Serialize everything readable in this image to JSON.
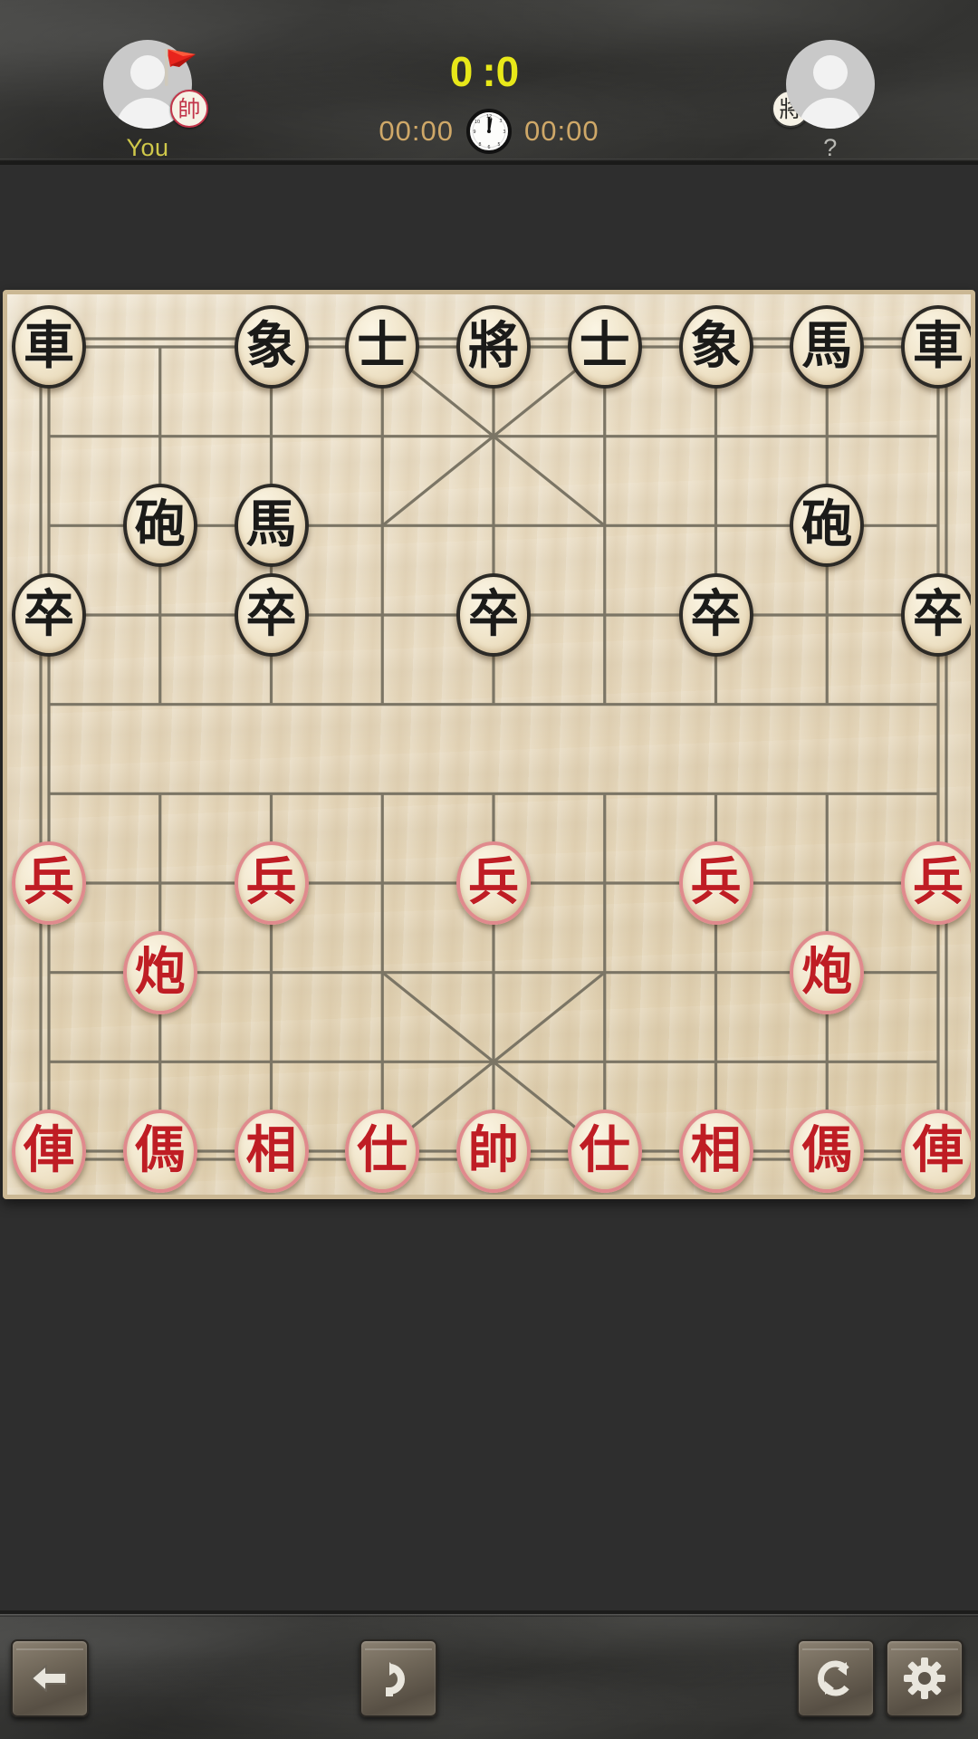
{
  "header": {
    "players": {
      "left": {
        "name": "You",
        "avatar_icon": "person-avatar-icon",
        "flag_icon": "red-flag-icon",
        "side_badge": "帥",
        "side_badge_name": "red-general-badge",
        "name_color": "#cfc84a"
      },
      "right": {
        "name": "?",
        "avatar_icon": "person-avatar-icon",
        "side_badge": "將",
        "side_badge_name": "black-general-badge",
        "name_color": "#b9b9b4"
      }
    },
    "score": {
      "left": "0",
      "separator": ":",
      "right": "0",
      "color": "#e8e819"
    },
    "clock_icon": "analog-clock-icon",
    "timers": {
      "left": "00:00",
      "right": "00:00",
      "color": "#cfa868"
    }
  },
  "board": {
    "files": 9,
    "ranks": 10,
    "river_label": "",
    "pieces": [
      {
        "name": "black-chariot",
        "glyph": "車",
        "side": "black",
        "file": 1,
        "rank": 1
      },
      {
        "name": "black-elephant",
        "glyph": "象",
        "side": "black",
        "file": 3,
        "rank": 1
      },
      {
        "name": "black-advisor",
        "glyph": "士",
        "side": "black",
        "file": 4,
        "rank": 1
      },
      {
        "name": "black-general",
        "glyph": "將",
        "side": "black",
        "file": 5,
        "rank": 1
      },
      {
        "name": "black-advisor",
        "glyph": "士",
        "side": "black",
        "file": 6,
        "rank": 1
      },
      {
        "name": "black-elephant",
        "glyph": "象",
        "side": "black",
        "file": 7,
        "rank": 1
      },
      {
        "name": "black-horse",
        "glyph": "馬",
        "side": "black",
        "file": 8,
        "rank": 1
      },
      {
        "name": "black-chariot",
        "glyph": "車",
        "side": "black",
        "file": 9,
        "rank": 1
      },
      {
        "name": "black-cannon",
        "glyph": "砲",
        "side": "black",
        "file": 2,
        "rank": 3
      },
      {
        "name": "black-horse",
        "glyph": "馬",
        "side": "black",
        "file": 3,
        "rank": 3
      },
      {
        "name": "black-cannon",
        "glyph": "砲",
        "side": "black",
        "file": 8,
        "rank": 3
      },
      {
        "name": "black-soldier",
        "glyph": "卒",
        "side": "black",
        "file": 1,
        "rank": 4
      },
      {
        "name": "black-soldier",
        "glyph": "卒",
        "side": "black",
        "file": 3,
        "rank": 4
      },
      {
        "name": "black-soldier",
        "glyph": "卒",
        "side": "black",
        "file": 5,
        "rank": 4
      },
      {
        "name": "black-soldier",
        "glyph": "卒",
        "side": "black",
        "file": 7,
        "rank": 4
      },
      {
        "name": "black-soldier",
        "glyph": "卒",
        "side": "black",
        "file": 9,
        "rank": 4
      },
      {
        "name": "red-soldier",
        "glyph": "兵",
        "side": "red",
        "file": 1,
        "rank": 7
      },
      {
        "name": "red-soldier",
        "glyph": "兵",
        "side": "red",
        "file": 3,
        "rank": 7
      },
      {
        "name": "red-soldier",
        "glyph": "兵",
        "side": "red",
        "file": 5,
        "rank": 7
      },
      {
        "name": "red-soldier",
        "glyph": "兵",
        "side": "red",
        "file": 7,
        "rank": 7
      },
      {
        "name": "red-soldier",
        "glyph": "兵",
        "side": "red",
        "file": 9,
        "rank": 7
      },
      {
        "name": "red-cannon",
        "glyph": "炮",
        "side": "red",
        "file": 2,
        "rank": 8
      },
      {
        "name": "red-cannon",
        "glyph": "炮",
        "side": "red",
        "file": 8,
        "rank": 8
      },
      {
        "name": "red-chariot",
        "glyph": "俥",
        "side": "red",
        "file": 1,
        "rank": 10
      },
      {
        "name": "red-horse",
        "glyph": "傌",
        "side": "red",
        "file": 2,
        "rank": 10
      },
      {
        "name": "red-elephant",
        "glyph": "相",
        "side": "red",
        "file": 3,
        "rank": 10
      },
      {
        "name": "red-advisor",
        "glyph": "仕",
        "side": "red",
        "file": 4,
        "rank": 10
      },
      {
        "name": "red-general",
        "glyph": "帥",
        "side": "red",
        "file": 5,
        "rank": 10
      },
      {
        "name": "red-advisor",
        "glyph": "仕",
        "side": "red",
        "file": 6,
        "rank": 10
      },
      {
        "name": "red-elephant",
        "glyph": "相",
        "side": "red",
        "file": 7,
        "rank": 10
      },
      {
        "name": "red-horse",
        "glyph": "傌",
        "side": "red",
        "file": 8,
        "rank": 10
      },
      {
        "name": "red-chariot",
        "glyph": "俥",
        "side": "red",
        "file": 9,
        "rank": 10
      }
    ]
  },
  "toolbar": {
    "buttons": [
      {
        "name": "back-button",
        "icon": "arrow-left-icon"
      },
      {
        "name": "undo-button",
        "icon": "undo-arrow-icon"
      },
      {
        "name": "restart-button",
        "icon": "refresh-circle-icon"
      },
      {
        "name": "settings-button",
        "icon": "gear-icon"
      }
    ]
  }
}
